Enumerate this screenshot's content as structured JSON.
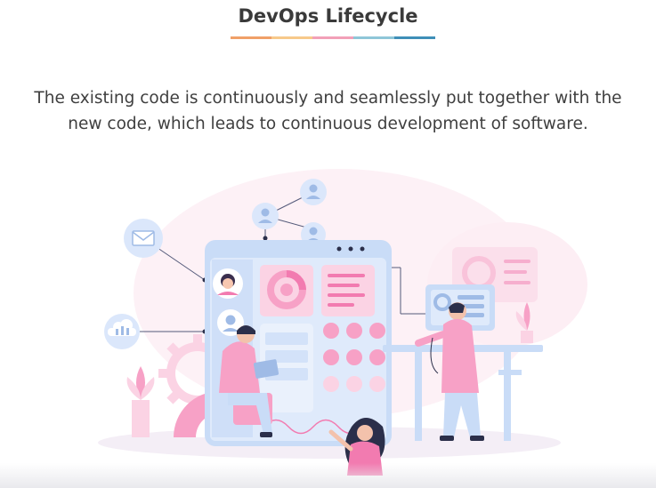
{
  "header": {
    "title": "DevOps Lifecycle",
    "underline_colors": [
      "#f0a068",
      "#f7c98a",
      "#f2a0b8",
      "#8fc6d8",
      "#3f8fb8"
    ]
  },
  "body": {
    "description": "The existing code is continuously and seamlessly put together with the new code, which leads to continuous development of software."
  },
  "illustration": {
    "icons": [
      "user-icon",
      "user-icon",
      "user-icon",
      "mail-icon",
      "cloud-icon",
      "avatar-woman",
      "avatar-man"
    ],
    "colors": {
      "accent_pink": "#f27bb0",
      "light_pink": "#fde4ef",
      "screen_blue": "#c9dcf7",
      "light_blue": "#e2ecfb",
      "dark_navy": "#2b2f4a"
    }
  }
}
